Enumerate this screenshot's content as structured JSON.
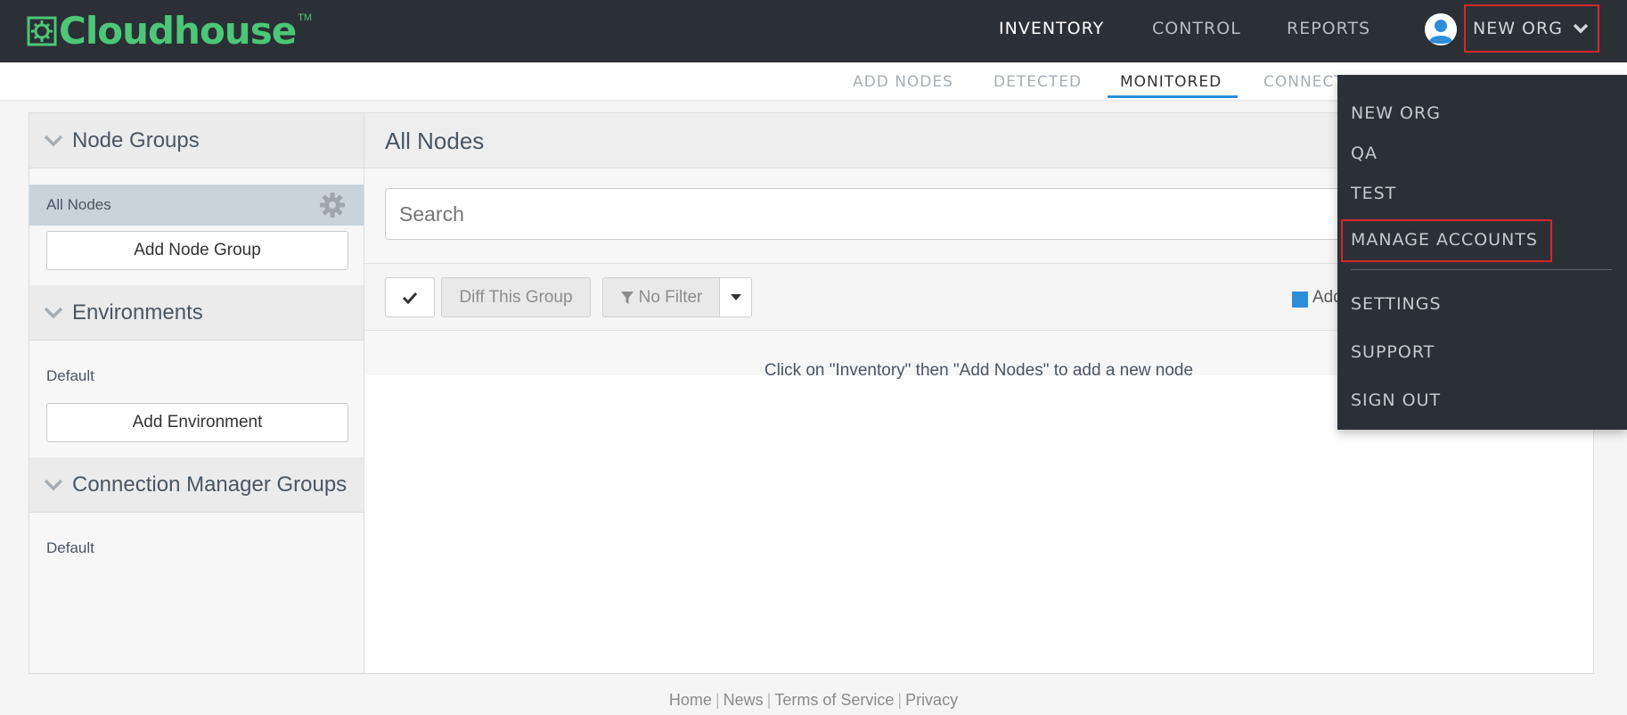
{
  "brand": {
    "name": "Cloudhouse",
    "trademark": "TM",
    "color": "#4cc777"
  },
  "topnav": {
    "items": [
      {
        "label": "INVENTORY",
        "active": true
      },
      {
        "label": "CONTROL",
        "active": false
      },
      {
        "label": "REPORTS",
        "active": false
      }
    ],
    "org_label": "NEW ORG"
  },
  "subnav": {
    "items": [
      {
        "label": "ADD NODES",
        "active": false
      },
      {
        "label": "DETECTED",
        "active": false
      },
      {
        "label": "MONITORED",
        "active": true
      },
      {
        "label": "CONNECT",
        "active": false
      }
    ],
    "accent": "#2f8fd8"
  },
  "sidebar": {
    "node_groups": {
      "title": "Node Groups",
      "items": [
        "All Nodes"
      ],
      "add_label": "Add Node Group"
    },
    "environments": {
      "title": "Environments",
      "items": [
        "Default"
      ],
      "add_label": "Add Environment"
    },
    "connection_manager_groups": {
      "title": "Connection Manager Groups",
      "items": [
        "Default"
      ]
    }
  },
  "main": {
    "title": "All Nodes",
    "search_placeholder": "Search",
    "toolbar": {
      "diff_label": "Diff This Group",
      "filter_label": "No Filter",
      "legend_label": "Add"
    },
    "empty_message": "Click on \"Inventory\" then \"Add Nodes\" to add a new node"
  },
  "footer": {
    "links": [
      "Home",
      "News",
      "Terms of Service",
      "Privacy"
    ]
  },
  "org_dropdown": {
    "orgs": [
      "NEW ORG",
      "QA",
      "TEST"
    ],
    "manage_label": "MANAGE ACCOUNTS",
    "settings_label": "SETTINGS",
    "support_label": "SUPPORT",
    "signout_label": "SIGN OUT",
    "highlight_color": "#d6262a"
  }
}
